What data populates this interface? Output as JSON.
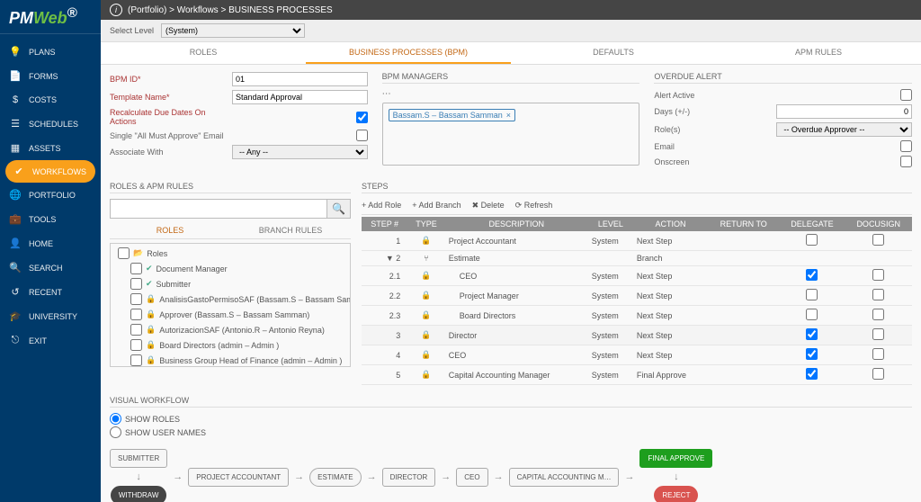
{
  "logo_text": "PM",
  "logo_accent": "Web",
  "nav": [
    {
      "icon": "💡",
      "label": "PLANS"
    },
    {
      "icon": "📄",
      "label": "FORMS"
    },
    {
      "icon": "$",
      "label": "COSTS"
    },
    {
      "icon": "☰",
      "label": "SCHEDULES"
    },
    {
      "icon": "▦",
      "label": "ASSETS"
    },
    {
      "icon": "✔",
      "label": "WORKFLOWS"
    },
    {
      "icon": "🌐",
      "label": "PORTFOLIO"
    },
    {
      "icon": "💼",
      "label": "TOOLS"
    },
    {
      "icon": "👤",
      "label": "HOME"
    },
    {
      "icon": "🔍",
      "label": "SEARCH"
    },
    {
      "icon": "↺",
      "label": "RECENT"
    },
    {
      "icon": "🎓",
      "label": "UNIVERSITY"
    },
    {
      "icon": "⎋",
      "label": "EXIT"
    }
  ],
  "nav_active_index": 5,
  "breadcrumb": "(Portfolio) > Workflows > BUSINESS PROCESSES",
  "level": {
    "label": "Select Level",
    "value": "(System)"
  },
  "tabs": [
    "ROLES",
    "BUSINESS PROCESSES (BPM)",
    "DEFAULTS",
    "APM RULES"
  ],
  "tabs_active": 1,
  "form": {
    "bpm_id": {
      "label": "BPM ID*",
      "value": "01"
    },
    "template": {
      "label": "Template Name*",
      "value": "Standard Approval"
    },
    "recalc": "Recalculate Due Dates On Actions",
    "single": "Single \"All Must Approve\" Email",
    "assoc": {
      "label": "Associate With",
      "value": "-- Any --"
    }
  },
  "mgr": {
    "header": "BPM MANAGERS",
    "chip": "Bassam.S – Bassam Samman"
  },
  "overdue": {
    "header": "OVERDUE ALERT",
    "alert": "Alert Active",
    "days": {
      "label": "Days (+/-)",
      "value": "0"
    },
    "roles": {
      "label": "Role(s)",
      "value": "-- Overdue Approver --"
    },
    "email": "Email",
    "onscreen": "Onscreen"
  },
  "roles_pane": {
    "header": "ROLES & APM RULES",
    "subtabs": [
      "ROLES",
      "BRANCH RULES"
    ],
    "subtabs_active": 0,
    "tree": [
      {
        "icon": "fold",
        "label": "Roles",
        "indent": 0
      },
      {
        "icon": "chk",
        "label": "Document Manager",
        "indent": 1
      },
      {
        "icon": "chk",
        "label": "Submitter",
        "indent": 1
      },
      {
        "icon": "lock",
        "label": "AnalisisGastoPermisoSAF (Bassam.S – Bassam Sam…",
        "indent": 1
      },
      {
        "icon": "lock",
        "label": "Approver (Bassam.S – Bassam Samman)",
        "indent": 1
      },
      {
        "icon": "lock",
        "label": "AutorizacionSAF (Antonio.R – Antonio Reyna)",
        "indent": 1
      },
      {
        "icon": "lock",
        "label": "Board Directors (admin – Admin )",
        "indent": 1
      },
      {
        "icon": "lock",
        "label": "Business Group Head of Finance (admin – Admin )",
        "indent": 1
      }
    ]
  },
  "steps_pane": {
    "header": "STEPS",
    "toolbar": [
      "+ Add Role",
      "+ Add Branch",
      "✖ Delete",
      "⟳ Refresh"
    ],
    "cols": [
      "STEP #",
      "TYPE",
      "DESCRIPTION",
      "LEVEL",
      "ACTION",
      "RETURN TO",
      "DELEGATE",
      "DOCUSIGN"
    ],
    "rows": [
      {
        "step": "1",
        "type": "🔒",
        "desc": "Project Accountant",
        "level": "System",
        "action": "Next Step",
        "delegate": false,
        "docusign": false,
        "indent": 0
      },
      {
        "step": "2",
        "type": "⑂",
        "desc": "Estimate",
        "level": "",
        "action": "Branch",
        "delegate": "",
        "docusign": "",
        "indent": 0,
        "expand": "▼"
      },
      {
        "step": "2.1",
        "type": "🔒",
        "desc": "CEO",
        "level": "System",
        "action": "Next Step",
        "delegate": true,
        "docusign": false,
        "indent": 1
      },
      {
        "step": "2.2",
        "type": "🔒",
        "desc": "Project Manager",
        "level": "System",
        "action": "Next Step",
        "delegate": false,
        "docusign": false,
        "indent": 1
      },
      {
        "step": "2.3",
        "type": "🔒",
        "desc": "Board Directors",
        "level": "System",
        "action": "Next Step",
        "delegate": false,
        "docusign": false,
        "indent": 1
      },
      {
        "step": "3",
        "type": "🔒",
        "desc": "Director",
        "level": "System",
        "action": "Next Step",
        "delegate": true,
        "docusign": false,
        "indent": 0,
        "alt": true
      },
      {
        "step": "4",
        "type": "🔒",
        "desc": "CEO",
        "level": "System",
        "action": "Next Step",
        "delegate": true,
        "docusign": false,
        "indent": 0
      },
      {
        "step": "5",
        "type": "🔒",
        "desc": "Capital Accounting Manager",
        "level": "System",
        "action": "Final Approve",
        "delegate": true,
        "docusign": false,
        "indent": 0
      }
    ]
  },
  "vwf": {
    "header": "VISUAL WORKFLOW",
    "show_roles": "SHOW ROLES",
    "show_users": "SHOW USER NAMES",
    "steps": [
      "SUBMITTER",
      "PROJECT ACCOUNTANT",
      "ESTIMATE",
      "DIRECTOR",
      "CEO",
      "CAPITAL ACCOUNTING M…",
      "FINAL APPROVE"
    ],
    "withdraw": "WITHDRAW",
    "reject": "REJECT"
  }
}
